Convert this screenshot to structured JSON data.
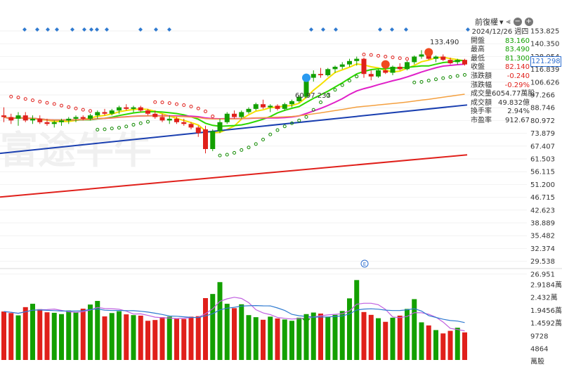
{
  "toolbar": {
    "adjust_label": "前復權",
    "adjust_icon": "chevron-down-icon",
    "chart_type_icon": "candle-chart-icon",
    "zoom_out_icon": "minus-circle-icon",
    "zoom_in_icon": "plus-circle-icon"
  },
  "info_panel": {
    "date": "2024/12/26 週四",
    "rows": [
      {
        "label": "開盤",
        "value": "83.160",
        "tone": "green"
      },
      {
        "label": "最高",
        "value": "83.490",
        "tone": "green"
      },
      {
        "label": "最低",
        "value": "81.300",
        "tone": "green"
      },
      {
        "label": "收盤",
        "value": "82.140",
        "tone": "red"
      },
      {
        "label": "漲跌額",
        "value": "-0.240",
        "tone": "red"
      },
      {
        "label": "漲跌幅",
        "value": "-0.29%",
        "tone": "red"
      },
      {
        "label": "成交量",
        "value": "6054.77萬股",
        "tone": "plain"
      },
      {
        "label": "成交額",
        "value": "49.832億",
        "tone": "plain"
      },
      {
        "label": "換手率",
        "value": "2.94%",
        "tone": "plain"
      },
      {
        "label": "市盈率",
        "value": "912.67",
        "tone": "plain"
      }
    ]
  },
  "current_price_tag": "121.298",
  "peak_label": "133.490",
  "low_label": "60.97.233",
  "watermark": "富途牛牛",
  "price_axis": [
    "153.825",
    "140.350",
    "128.054",
    "116.839",
    "106.626",
    "97.266",
    "88.746",
    "80.972",
    "73.879",
    "67.407",
    "61.503",
    "56.115",
    "51.200",
    "46.715",
    "42.623",
    "38.889",
    "35.482",
    "32.374",
    "29.538",
    "26.951"
  ],
  "volume_axis": [
    "2.9184萬",
    "2.432萬",
    "1.9456萬",
    "1.4592萬",
    "9728",
    "4864",
    "萬股"
  ],
  "chart_data": {
    "type": "candlestick",
    "log_scale": true,
    "colors": {
      "up": "#13a000",
      "down": "#e0201b",
      "ma_yellow": "#f5e000",
      "ma_green": "#2dd800",
      "ma_magenta": "#e020c8",
      "ma_orange": "#f4a040",
      "ma_blue": "#1a3fb0",
      "ma_red": "#e0201b",
      "sar": "#118a00",
      "vol_ma_blue": "#2f7ad0",
      "vol_ma_purple": "#c060e0",
      "signal": "#2a9af0"
    },
    "candles": [
      {
        "o": 84,
        "h": 89,
        "l": 80,
        "c": 83
      },
      {
        "o": 83,
        "h": 85,
        "l": 79,
        "c": 81
      },
      {
        "o": 82,
        "h": 86,
        "l": 78,
        "c": 84
      },
      {
        "o": 84,
        "h": 86,
        "l": 80,
        "c": 81
      },
      {
        "o": 81,
        "h": 84,
        "l": 79,
        "c": 82
      },
      {
        "o": 82,
        "h": 84,
        "l": 79,
        "c": 80
      },
      {
        "o": 80,
        "h": 82,
        "l": 78,
        "c": 79
      },
      {
        "o": 79,
        "h": 81,
        "l": 77,
        "c": 80
      },
      {
        "o": 80,
        "h": 82,
        "l": 78,
        "c": 81
      },
      {
        "o": 81,
        "h": 83,
        "l": 79,
        "c": 82
      },
      {
        "o": 82,
        "h": 84,
        "l": 80,
        "c": 83
      },
      {
        "o": 83,
        "h": 84,
        "l": 81,
        "c": 82
      },
      {
        "o": 82,
        "h": 85,
        "l": 81,
        "c": 84
      },
      {
        "o": 84,
        "h": 87,
        "l": 82,
        "c": 86
      },
      {
        "o": 86,
        "h": 88,
        "l": 84,
        "c": 85
      },
      {
        "o": 85,
        "h": 88,
        "l": 84,
        "c": 87
      },
      {
        "o": 87,
        "h": 90,
        "l": 85,
        "c": 89
      },
      {
        "o": 89,
        "h": 91,
        "l": 87,
        "c": 88
      },
      {
        "o": 88,
        "h": 90,
        "l": 86,
        "c": 89
      },
      {
        "o": 89,
        "h": 90,
        "l": 86,
        "c": 87
      },
      {
        "o": 87,
        "h": 88,
        "l": 84,
        "c": 85
      },
      {
        "o": 85,
        "h": 87,
        "l": 82,
        "c": 83
      },
      {
        "o": 83,
        "h": 85,
        "l": 80,
        "c": 81
      },
      {
        "o": 81,
        "h": 84,
        "l": 79,
        "c": 82
      },
      {
        "o": 82,
        "h": 83,
        "l": 79,
        "c": 80
      },
      {
        "o": 80,
        "h": 82,
        "l": 78,
        "c": 79
      },
      {
        "o": 79,
        "h": 80,
        "l": 76,
        "c": 77
      },
      {
        "o": 77,
        "h": 78,
        "l": 72,
        "c": 74
      },
      {
        "o": 76,
        "h": 78,
        "l": 64,
        "c": 66
      },
      {
        "o": 66,
        "h": 76,
        "l": 65,
        "c": 75
      },
      {
        "o": 75,
        "h": 82,
        "l": 74,
        "c": 80
      },
      {
        "o": 80,
        "h": 86,
        "l": 79,
        "c": 85
      },
      {
        "o": 85,
        "h": 87,
        "l": 82,
        "c": 83
      },
      {
        "o": 83,
        "h": 87,
        "l": 82,
        "c": 86
      },
      {
        "o": 86,
        "h": 89,
        "l": 85,
        "c": 88
      },
      {
        "o": 88,
        "h": 92,
        "l": 87,
        "c": 91
      },
      {
        "o": 91,
        "h": 94,
        "l": 88,
        "c": 89
      },
      {
        "o": 89,
        "h": 91,
        "l": 86,
        "c": 90
      },
      {
        "o": 90,
        "h": 91,
        "l": 87,
        "c": 88
      },
      {
        "o": 88,
        "h": 92,
        "l": 87,
        "c": 91
      },
      {
        "o": 91,
        "h": 94,
        "l": 89,
        "c": 93
      },
      {
        "o": 93,
        "h": 97,
        "l": 92,
        "c": 96
      },
      {
        "o": 96,
        "h": 112,
        "l": 95,
        "c": 110
      },
      {
        "o": 110,
        "h": 116,
        "l": 107,
        "c": 113
      },
      {
        "o": 113,
        "h": 118,
        "l": 110,
        "c": 112
      },
      {
        "o": 112,
        "h": 118,
        "l": 111,
        "c": 117
      },
      {
        "o": 117,
        "h": 120,
        "l": 114,
        "c": 119
      },
      {
        "o": 119,
        "h": 123,
        "l": 117,
        "c": 121
      },
      {
        "o": 121,
        "h": 126,
        "l": 119,
        "c": 124
      },
      {
        "o": 124,
        "h": 128,
        "l": 120,
        "c": 126
      },
      {
        "o": 126,
        "h": 127,
        "l": 110,
        "c": 113
      },
      {
        "o": 113,
        "h": 116,
        "l": 108,
        "c": 111
      },
      {
        "o": 111,
        "h": 117,
        "l": 110,
        "c": 116
      },
      {
        "o": 116,
        "h": 119,
        "l": 113,
        "c": 114
      },
      {
        "o": 114,
        "h": 120,
        "l": 112,
        "c": 119
      },
      {
        "o": 119,
        "h": 122,
        "l": 116,
        "c": 117
      },
      {
        "o": 117,
        "h": 124,
        "l": 116,
        "c": 123
      },
      {
        "o": 123,
        "h": 129,
        "l": 121,
        "c": 128
      },
      {
        "o": 128,
        "h": 134,
        "l": 126,
        "c": 130
      },
      {
        "o": 130,
        "h": 133,
        "l": 125,
        "c": 126
      },
      {
        "o": 126,
        "h": 129,
        "l": 123,
        "c": 128
      },
      {
        "o": 128,
        "h": 130,
        "l": 124,
        "c": 125
      },
      {
        "o": 125,
        "h": 127,
        "l": 121,
        "c": 122
      },
      {
        "o": 123,
        "h": 126,
        "l": 121,
        "c": 125
      },
      {
        "o": 125,
        "h": 126,
        "l": 120,
        "c": 121
      }
    ],
    "volumes": [
      18800,
      18200,
      17300,
      20500,
      21800,
      19700,
      18500,
      18300,
      17800,
      19200,
      18500,
      19900,
      21500,
      22900,
      16900,
      18200,
      18900,
      17700,
      17400,
      17200,
      15200,
      15500,
      16600,
      16800,
      16200,
      15900,
      16800,
      17000,
      24000,
      25600,
      30200,
      21800,
      20100,
      21600,
      17400,
      16600,
      15600,
      16800,
      16100,
      15700,
      15200,
      16400,
      17800,
      18400,
      18000,
      16800,
      17500,
      19000,
      23900,
      31000,
      18600,
      17500,
      16200,
      14800,
      16400,
      17200,
      19800,
      23600,
      14600,
      13400,
      11600,
      10300,
      11300,
      12500,
      10700
    ],
    "signals": [
      {
        "index": 42,
        "type": "buy",
        "value": 110
      },
      {
        "index": 53,
        "type": "sell",
        "value": 121
      },
      {
        "index": 59,
        "type": "sell",
        "value": 132
      }
    ],
    "markers": [
      {
        "index": 42,
        "type": "arrow-down",
        "volume": true
      }
    ]
  }
}
